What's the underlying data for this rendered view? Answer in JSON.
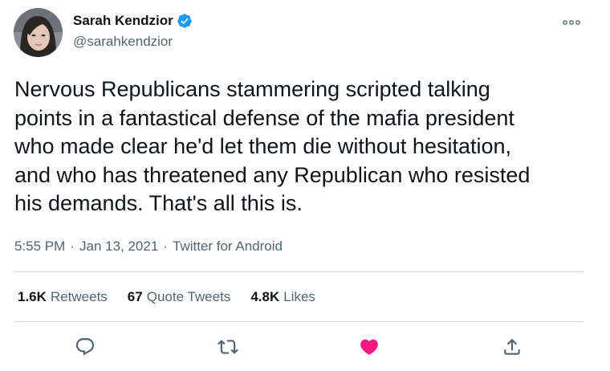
{
  "author": {
    "display_name": "Sarah Kendzior",
    "handle": "@sarahkendzior",
    "verified": true
  },
  "tweet": {
    "text": "Nervous Republicans stammering scripted talking\npoints in a fantastical defense of the mafia president\nwho made clear he'd let them die without hesitation,\nand who has threatened any Republican who resisted\nhis demands. That's all this is.",
    "time": "5:55 PM",
    "separator": "·",
    "date": "Jan 13, 2021",
    "source": "Twitter for Android"
  },
  "stats": {
    "retweets_count": "1.6K",
    "retweets_label": "Retweets",
    "quotes_count": "67",
    "quotes_label": "Quote Tweets",
    "likes_count": "4.8K",
    "likes_label": "Likes"
  },
  "actions": {
    "reply_icon": "reply-icon",
    "retweet_icon": "retweet-icon",
    "like_icon": "heart-icon",
    "share_icon": "share-icon",
    "liked": true
  },
  "colors": {
    "verified_blue": "#1d9bf0",
    "like_red": "#f91880",
    "secondary_text": "#536471",
    "divider": "#cfd9de"
  }
}
